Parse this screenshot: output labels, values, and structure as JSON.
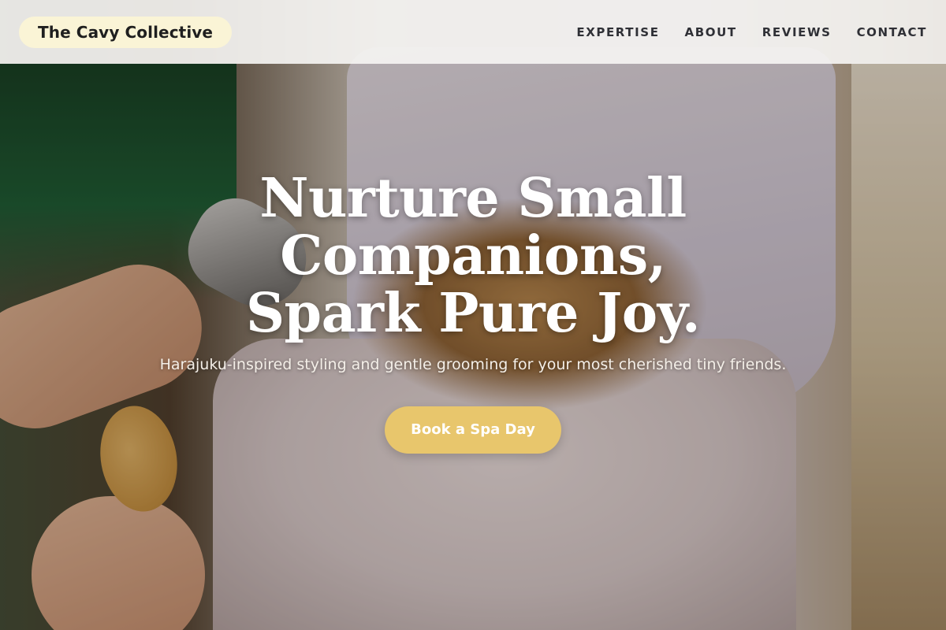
{
  "header": {
    "brand": "The Cavy Collective",
    "nav": [
      {
        "label": "EXPERTISE"
      },
      {
        "label": "ABOUT"
      },
      {
        "label": "REVIEWS"
      },
      {
        "label": "CONTACT"
      }
    ]
  },
  "hero": {
    "headline_lines": [
      "Nurture Small",
      "Companions,",
      "Spark Pure Joy."
    ],
    "subtext": "Harajuku-inspired styling and gentle grooming for your most cherished tiny friends.",
    "cta_label": "Book a Spa Day"
  },
  "colors": {
    "topbar_bg": "#f5f4f2",
    "brand_pill_bg": "#faf4d6",
    "cta_bg": "#e8c66c",
    "headline": "#ffffff"
  }
}
